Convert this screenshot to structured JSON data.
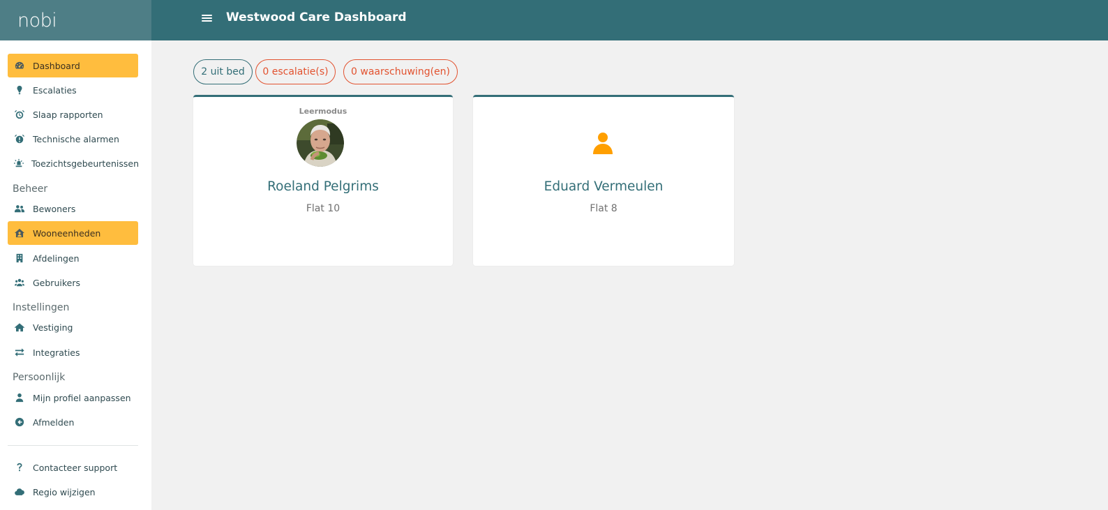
{
  "app": {
    "logo": "nobi",
    "title": "Westwood Care Dashboard"
  },
  "sidebar": {
    "items": [
      {
        "label": "Dashboard",
        "icon": "gauge-icon",
        "active": true
      },
      {
        "label": "Escalaties",
        "icon": "exclamation-icon",
        "active": false
      },
      {
        "label": "Slaap rapporten",
        "icon": "alarm-clock-icon",
        "active": false
      },
      {
        "label": "Technische alarmen",
        "icon": "alarm-warning-icon",
        "active": false
      },
      {
        "label": "Toezichtsgebeurtenissen",
        "icon": "siren-icon",
        "active": false
      }
    ],
    "beheer_label": "Beheer",
    "beheer_items": [
      {
        "label": "Bewoners",
        "icon": "users-icon",
        "active": false
      },
      {
        "label": "Wooneenheden",
        "icon": "house-user-icon",
        "active": true
      },
      {
        "label": "Afdelingen",
        "icon": "building-icon",
        "active": false
      },
      {
        "label": "Gebruikers",
        "icon": "users-group-icon",
        "active": false
      }
    ],
    "instellingen_label": "Instellingen",
    "instellingen_items": [
      {
        "label": "Vestiging",
        "icon": "home-icon",
        "active": false
      },
      {
        "label": "Integraties",
        "icon": "arrows-exchange-icon",
        "active": false
      }
    ],
    "persoonlijk_label": "Persoonlijk",
    "persoonlijk_items": [
      {
        "label": "Mijn profiel aanpassen",
        "icon": "user-icon",
        "active": false
      },
      {
        "label": "Afmelden",
        "icon": "arrow-circle-left-icon",
        "active": false
      }
    ],
    "footer_items": [
      {
        "label": "Contacteer support",
        "icon": "question-icon",
        "active": false
      },
      {
        "label": "Regio wijzigen",
        "icon": "cloud-icon",
        "active": false
      }
    ]
  },
  "badges": {
    "out_of_bed": "2 uit bed",
    "escalations": "0 escalatie(s)",
    "warnings": "0 waarschuwing(en)"
  },
  "residents": [
    {
      "mode": "Leermodus",
      "name": "Roeland Pelgrims",
      "flat": "Flat 10",
      "has_photo": true
    },
    {
      "mode": "",
      "name": "Eduard Vermeulen",
      "flat": "Flat 8",
      "has_photo": false
    }
  ],
  "colors": {
    "primary": "#336e77",
    "accent": "#ffbd3e",
    "warning": "#e2522f",
    "person_icon": "#ff9f00"
  }
}
